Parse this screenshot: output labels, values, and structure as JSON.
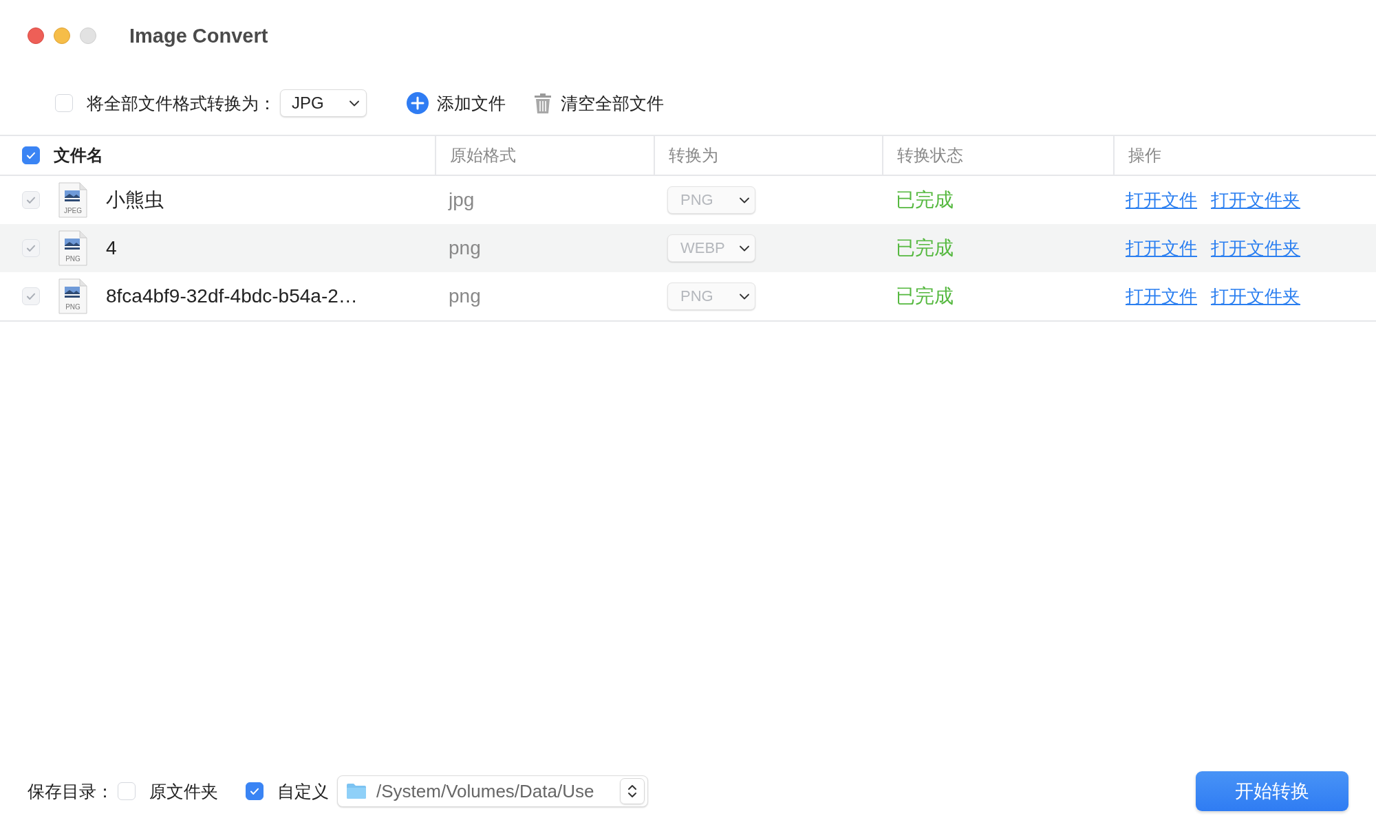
{
  "window": {
    "title": "Image Convert"
  },
  "toolbar": {
    "convert_all": {
      "label": "将全部文件格式转换为：",
      "checked": false,
      "format": "JPG"
    },
    "add_button": "添加文件",
    "clear_button": "清空全部文件"
  },
  "table": {
    "select_all_checked": true,
    "columns": [
      "文件名",
      "原始格式",
      "转换为",
      "转换状态",
      "操作"
    ],
    "rows": [
      {
        "checked": true,
        "disabled": true,
        "selected": false,
        "file_type": "JPEG",
        "name": "小熊虫",
        "original_format": "jpg",
        "convert_to": "PNG",
        "status": "已完成",
        "actions": [
          "打开文件",
          "打开文件夹"
        ]
      },
      {
        "checked": true,
        "disabled": true,
        "selected": true,
        "file_type": "PNG",
        "name": "4",
        "original_format": "png",
        "convert_to": "WEBP",
        "status": "已完成",
        "actions": [
          "打开文件",
          "打开文件夹"
        ]
      },
      {
        "checked": true,
        "disabled": true,
        "selected": false,
        "file_type": "PNG",
        "name": "8fca4bf9-32df-4bdc-b54a-2…",
        "original_format": "png",
        "convert_to": "PNG",
        "status": "已完成",
        "actions": [
          "打开文件",
          "打开文件夹"
        ]
      }
    ]
  },
  "footer": {
    "label": "保存目录：",
    "options": [
      {
        "label": "原文件夹",
        "checked": false
      },
      {
        "label": "自定义",
        "checked": true
      }
    ],
    "path": "/System/Volumes/Data/Use",
    "start_button": "开始转换"
  }
}
